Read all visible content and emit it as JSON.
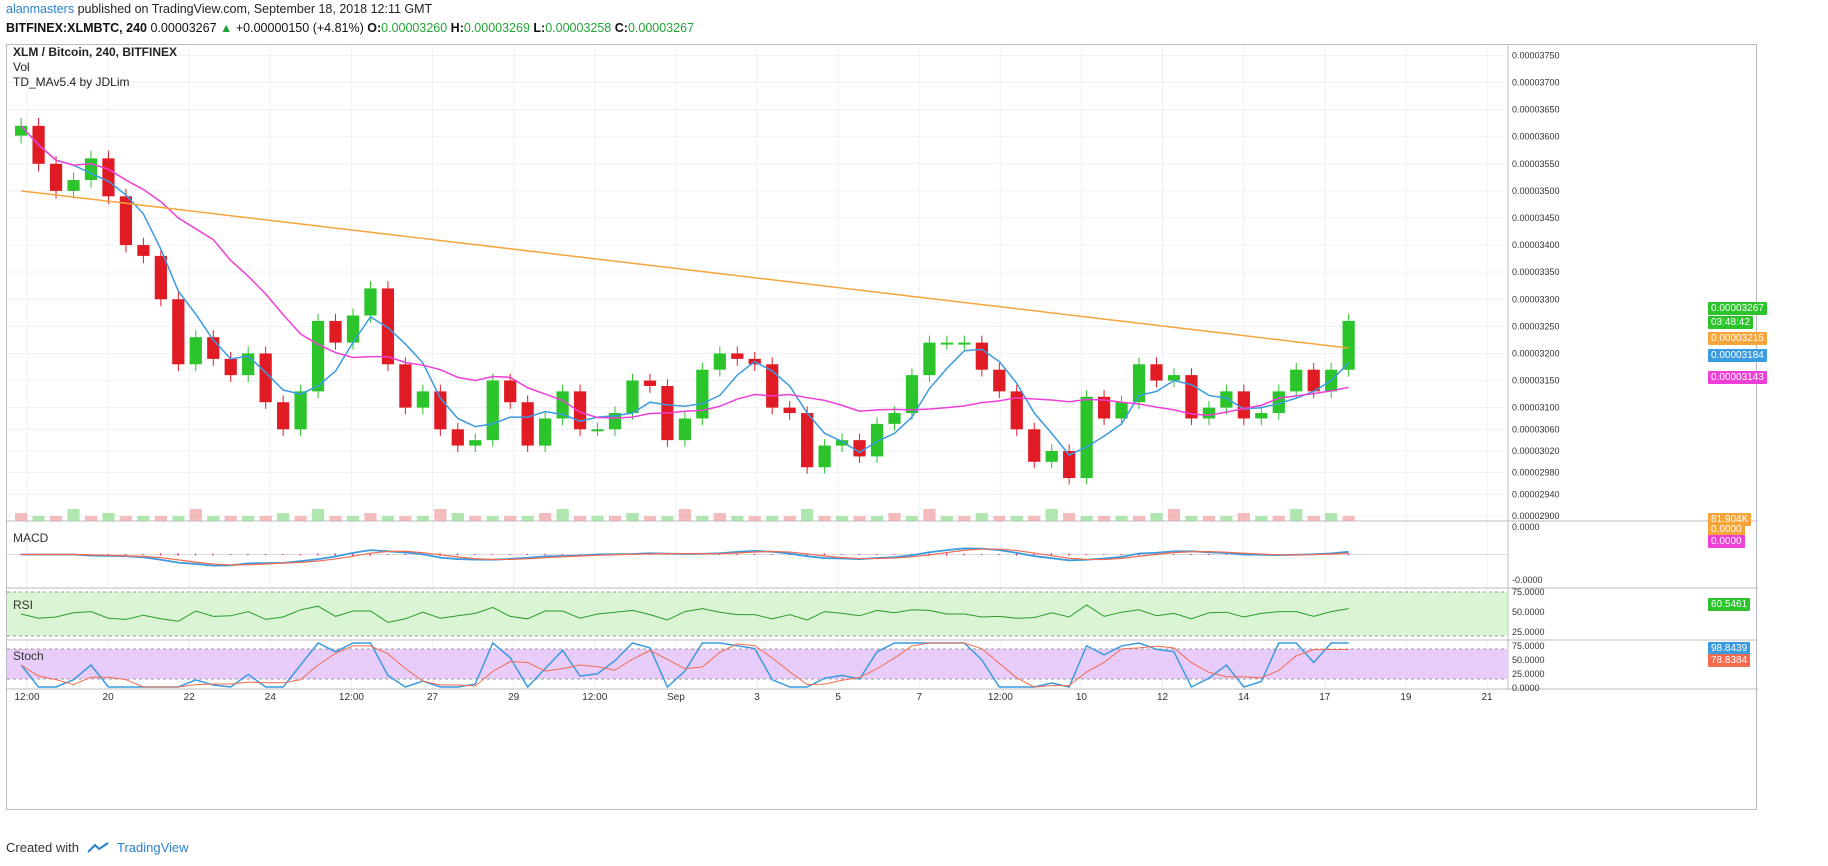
{
  "header": {
    "author": "alanmasters",
    "published": "published on TradingView.com, September 18, 2018 12:11 GMT",
    "symbol": "BITFINEX:XLMBTC, 240",
    "last": "0.00003267",
    "change": "+0.00000150 (+4.81%)",
    "open_label": "O:",
    "open": "0.00003260",
    "high_label": "H:",
    "high": "0.00003269",
    "low_label": "L:",
    "low": "0.00003258",
    "close_label": "C:",
    "close": "0.00003267"
  },
  "legend": {
    "title": "XLM / Bitcoin, 240, BITFINEX",
    "vol": "Vol",
    "indicator": "TD_MAv5.4 by JDLim"
  },
  "panes": {
    "macd": "MACD",
    "rsi": "RSI",
    "stoch": "Stoch"
  },
  "price_tags": {
    "last": "0.00003267",
    "countdown": "03:48:42",
    "ma200": "0.00003215",
    "ma_fast": "0.00003184",
    "ma50": "0.00003143",
    "volume": "81.904K",
    "macd_a": "0.0000",
    "macd_b": "0.0000",
    "rsi": "60.5461",
    "stoch_k": "98.8439",
    "stoch_d": "78.8384"
  },
  "colors": {
    "up": "#2bc42b",
    "down": "#e01b24",
    "ma_fast": "#3a9be0",
    "ma50": "#ee3fd6",
    "ma200": "#f7a43b",
    "rsi_fill": "#d9f5d3",
    "stoch_fill": "#e8ccfa"
  },
  "footer": {
    "created_with": "Created with",
    "brand": "TradingView"
  },
  "chart_data": {
    "type": "candlestick",
    "title": "XLM / Bitcoin, 240, BITFINEX",
    "x_ticks": [
      "12:00",
      "20",
      "22",
      "24",
      "12:00",
      "27",
      "29",
      "12:00",
      "Sep",
      "3",
      "5",
      "7",
      "12:00",
      "10",
      "12",
      "14",
      "17",
      "19",
      "21"
    ],
    "y_ticks": [
      "0.00003750",
      "0.00003700",
      "0.00003650",
      "0.00003600",
      "0.00003550",
      "0.00003500",
      "0.00003450",
      "0.00003400",
      "0.00003350",
      "0.00003300",
      "0.00003250",
      "0.00003200",
      "0.00003150",
      "0.00003100",
      "0.00003060",
      "0.00003020",
      "0.00002980",
      "0.00002940",
      "0.00002900"
    ],
    "ylim": [
      2.9e-05,
      3.76e-05
    ],
    "series": [
      {
        "name": "XLMBTC",
        "close": [
          3.62e-05,
          3.55e-05,
          3.5e-05,
          3.52e-05,
          3.56e-05,
          3.49e-05,
          3.4e-05,
          3.38e-05,
          3.3e-05,
          3.18e-05,
          3.23e-05,
          3.19e-05,
          3.16e-05,
          3.2e-05,
          3.11e-05,
          3.06e-05,
          3.13e-05,
          3.26e-05,
          3.22e-05,
          3.27e-05,
          3.32e-05,
          3.18e-05,
          3.1e-05,
          3.13e-05,
          3.06e-05,
          3.03e-05,
          3.04e-05,
          3.15e-05,
          3.11e-05,
          3.03e-05,
          3.08e-05,
          3.13e-05,
          3.06e-05,
          3.06e-05,
          3.09e-05,
          3.15e-05,
          3.14e-05,
          3.04e-05,
          3.08e-05,
          3.17e-05,
          3.2e-05,
          3.19e-05,
          3.18e-05,
          3.1e-05,
          3.09e-05,
          2.99e-05,
          3.03e-05,
          3.04e-05,
          3.01e-05,
          3.07e-05,
          3.09e-05,
          3.16e-05,
          3.22e-05,
          3.22e-05,
          3.22e-05,
          3.17e-05,
          3.13e-05,
          3.06e-05,
          3e-05,
          3.02e-05,
          2.97e-05,
          3.12e-05,
          3.08e-05,
          3.11e-05,
          3.18e-05,
          3.15e-05,
          3.16e-05,
          3.08e-05,
          3.1e-05,
          3.13e-05,
          3.08e-05,
          3.09e-05,
          3.13e-05,
          3.17e-05,
          3.13e-05,
          3.17e-05,
          3.26e-05
        ]
      }
    ],
    "indicators": [
      "Vol",
      "TD_MAv5.4 by JDLim",
      "MACD",
      "RSI",
      "Stoch"
    ],
    "rsi_ticks": [
      "75.0000",
      "50.0000",
      "25.0000"
    ],
    "stoch_ticks": [
      "75.0000",
      "50.0000",
      "25.0000",
      "0.0000"
    ],
    "macd_ticks": [
      "0.0000",
      "-0.0000"
    ]
  }
}
